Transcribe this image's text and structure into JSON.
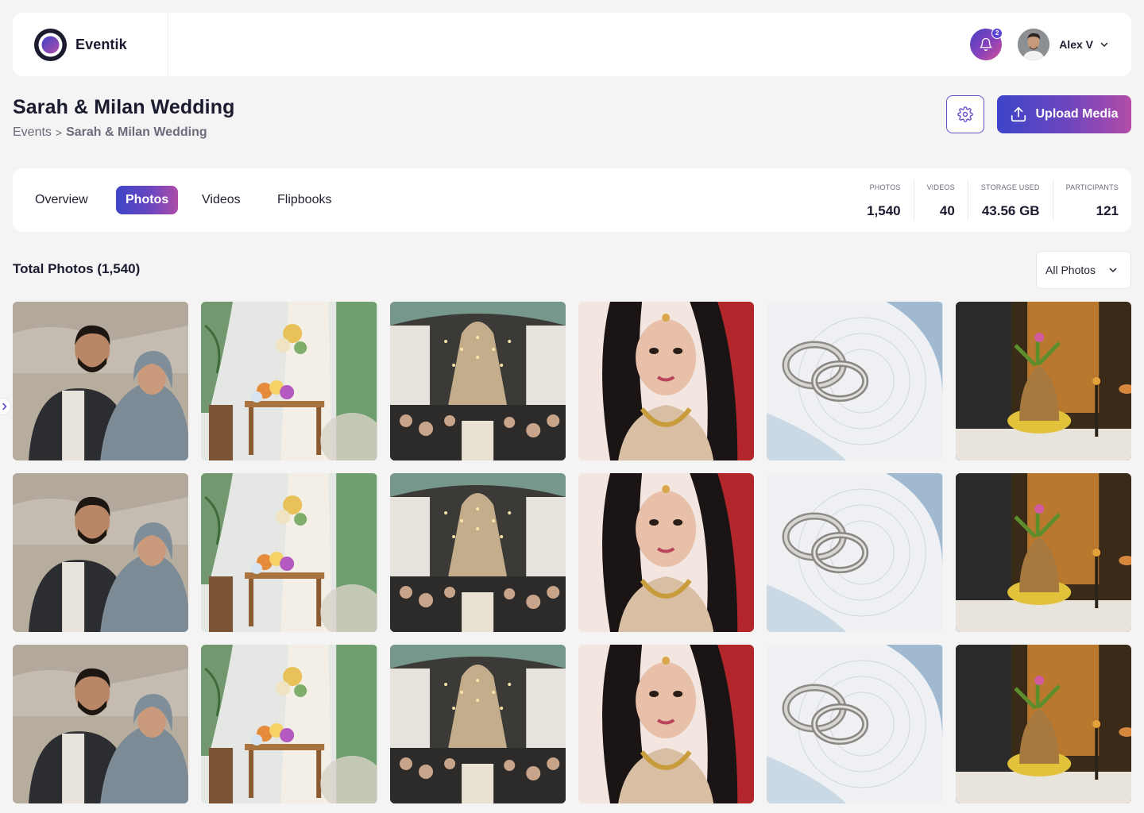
{
  "app": {
    "name": "Eventik",
    "notification_count": "2",
    "user_name": "Alex V"
  },
  "page": {
    "title": "Sarah & Milan Wedding",
    "breadcrumb": {
      "parent": "Events",
      "separator": ">",
      "current": "Sarah & Milan Wedding"
    },
    "upload_label": "Upload Media"
  },
  "tabs": [
    {
      "label": "Overview",
      "active": false
    },
    {
      "label": "Photos",
      "active": true
    },
    {
      "label": "Videos",
      "active": false
    },
    {
      "label": "Flipbooks",
      "active": false
    }
  ],
  "stats": [
    {
      "label": "PHOTOS",
      "value": "1,540"
    },
    {
      "label": "VIDEOS",
      "value": "40"
    },
    {
      "label": "STORAGE USED",
      "value": "43.56 GB"
    },
    {
      "label": "PARTICIPANTS",
      "value": "121"
    }
  ],
  "gallery": {
    "title": "Total Photos (1,540)",
    "filter_label": "All Photos",
    "rows": 3,
    "photos": [
      {
        "subject": "couple-portrait"
      },
      {
        "subject": "floral-table-setup"
      },
      {
        "subject": "reception-hall"
      },
      {
        "subject": "bride-portrait"
      },
      {
        "subject": "wedding-rings"
      },
      {
        "subject": "ceremony-ritual"
      }
    ]
  },
  "colors": {
    "brand_gradient_start": "#3d45c8",
    "brand_gradient_mid": "#6a46c0",
    "brand_gradient_end": "#b34ca8",
    "background": "#f4f4f5"
  },
  "icons": {
    "logo": "eventik-logo-icon",
    "notification": "bell-icon",
    "user_menu": "chevron-down-icon",
    "settings": "gear-icon",
    "upload": "upload-icon",
    "filter": "chevron-down-icon",
    "sidebar_toggle": "chevron-right-icon"
  }
}
